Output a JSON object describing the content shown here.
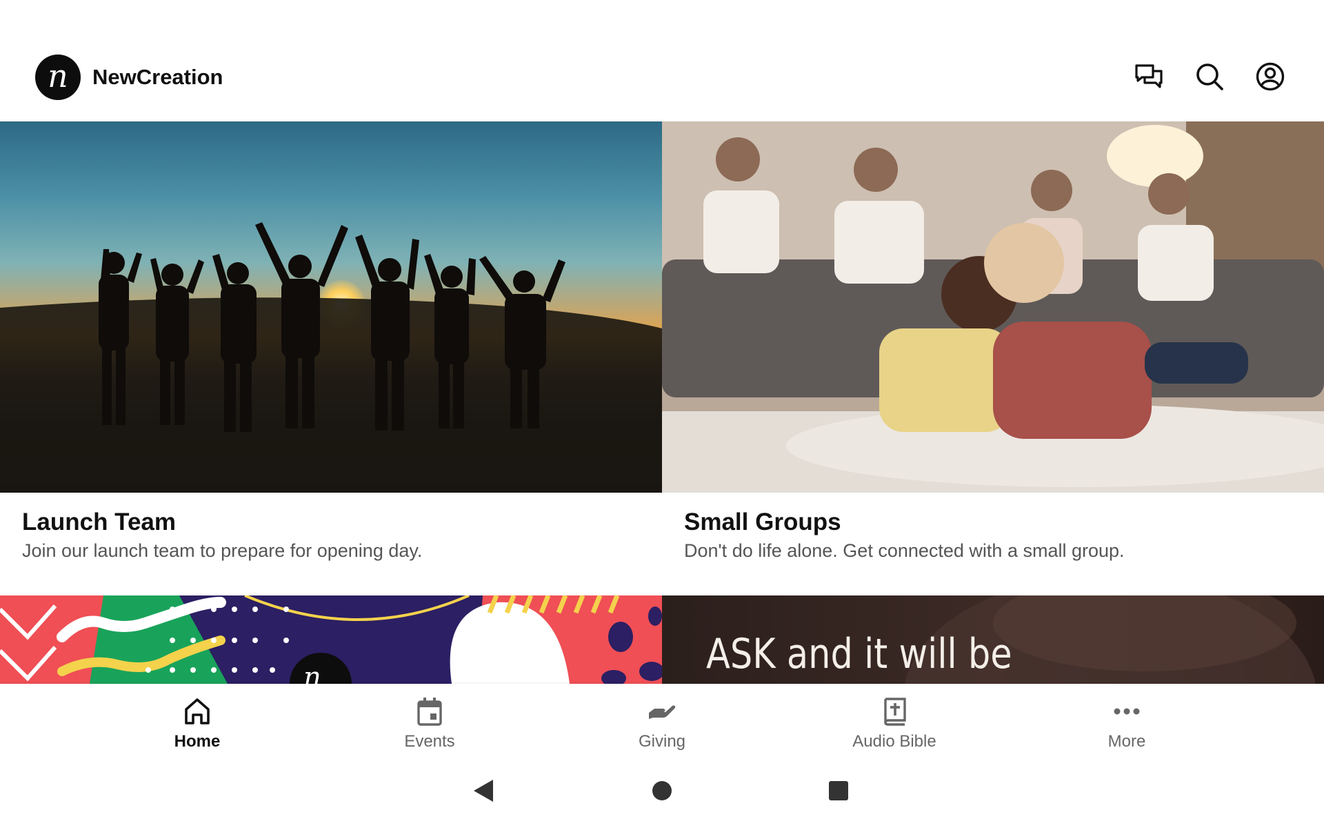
{
  "app": {
    "name": "NewCreation",
    "logo_letter": "n"
  },
  "header": {
    "icons": [
      "chat-icon",
      "search-icon",
      "account-icon"
    ]
  },
  "cards": [
    {
      "title": "Launch Team",
      "subtitle": "Join our launch team to prepare for opening day."
    },
    {
      "title": "Small Groups",
      "subtitle": "Don't do life alone. Get connected with a small group."
    },
    {
      "title": "",
      "subtitle": ""
    },
    {
      "title": "",
      "subtitle": "",
      "image_text": "ASK and it will be"
    }
  ],
  "bottom_nav": {
    "items": [
      {
        "label": "Home",
        "icon": "home-icon",
        "active": true
      },
      {
        "label": "Events",
        "icon": "calendar-icon",
        "active": false
      },
      {
        "label": "Giving",
        "icon": "giving-hand-icon",
        "active": false
      },
      {
        "label": "Audio Bible",
        "icon": "bible-icon",
        "active": false
      },
      {
        "label": "More",
        "icon": "more-icon",
        "active": false
      }
    ]
  },
  "system_nav": [
    "back-icon",
    "home-circle-icon",
    "recents-icon"
  ],
  "colors": {
    "active": "#111111",
    "inactive": "#666666",
    "logo_bg": "#0d0d0d"
  }
}
